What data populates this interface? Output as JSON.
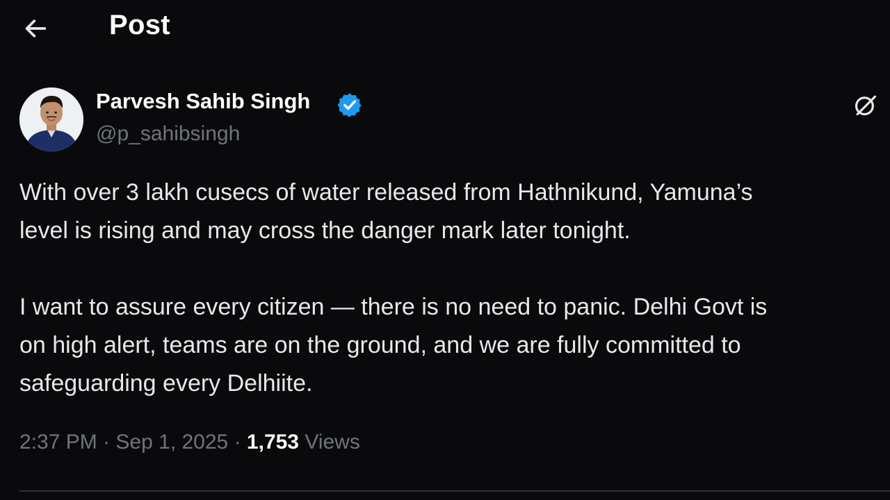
{
  "header": {
    "title": "Post",
    "back_icon": "arrow-left-icon"
  },
  "author": {
    "name": "Parvesh Sahib Singh",
    "handle": "@p_sahibsingh",
    "verified_icon": "verified-badge-icon",
    "verified_color": "#1d9bf0"
  },
  "post": {
    "paragraph1_line1": "With over 3 lakh cusecs of water released from Hathnikund, Yamuna’s",
    "paragraph1_line2": "level is rising and may cross the danger mark later tonight.",
    "paragraph2_line1": "I want to assure every citizen — there is no need to panic. Delhi Govt is",
    "paragraph2_line2": "on high alert, teams are on the ground, and we are fully committed to",
    "paragraph2_line3": "safeguarding every Delhiite."
  },
  "meta": {
    "time": "2:37 PM",
    "separator": "·",
    "date": "Sep 1, 2025",
    "views_count": "1,753",
    "views_label": "Views"
  },
  "actions": {
    "grok_icon": "grok-icon"
  },
  "colors": {
    "background": "#0a0a0c",
    "text": "#e7e9ea",
    "muted": "#6f757b",
    "accent": "#1d9bf0"
  }
}
